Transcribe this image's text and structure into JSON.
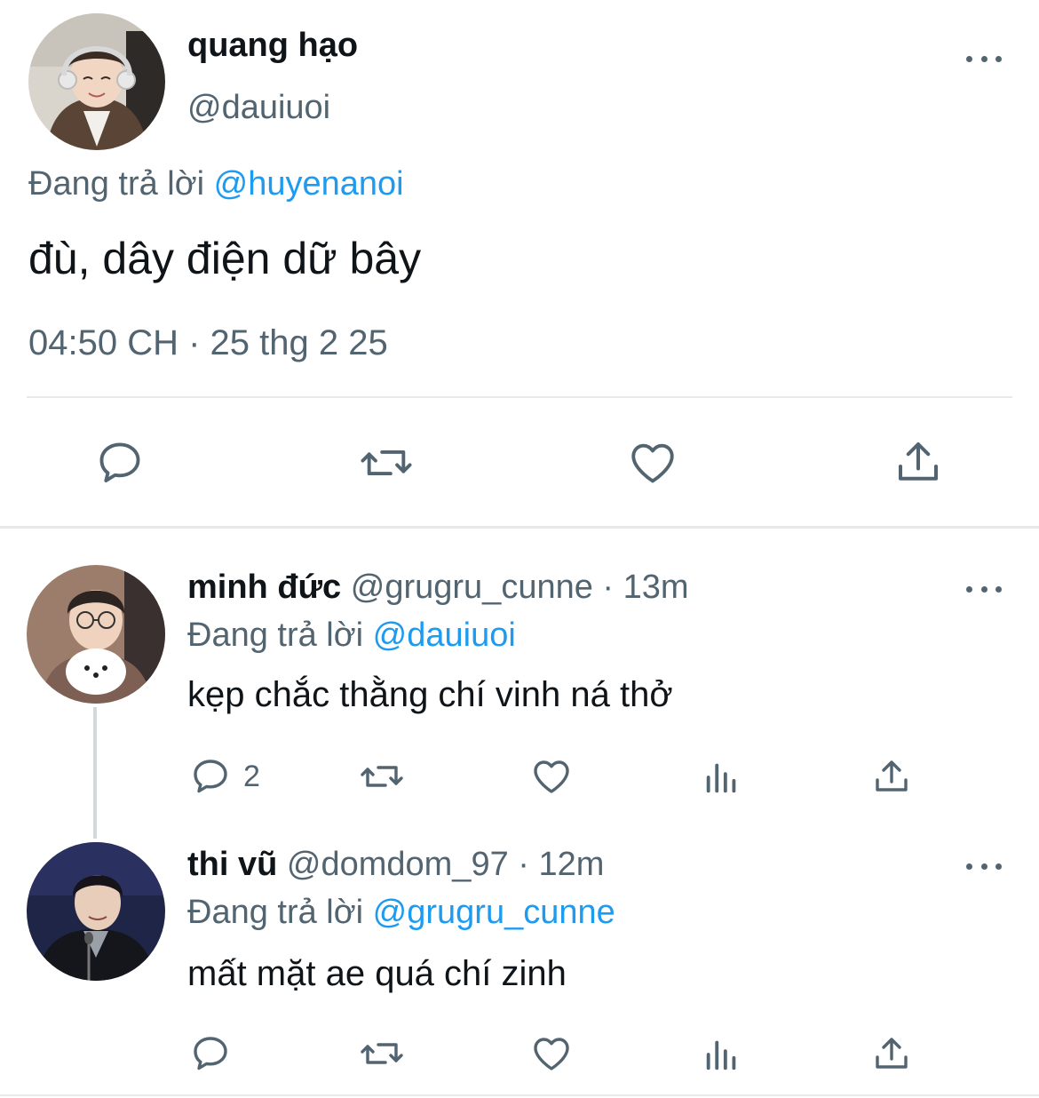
{
  "main_tweet": {
    "display_name": "quang hạo",
    "handle": "@dauiuoi",
    "replying_to_prefix": "Đang trả lời",
    "replying_to_handle": "@huyenanoi",
    "text": "đù, dây điện dữ bây",
    "timestamp": "04:50 CH · 25 thg 2 25",
    "actions": [
      "reply-icon",
      "retweet-icon",
      "like-icon",
      "share-icon"
    ]
  },
  "replies": [
    {
      "display_name": "minh đức",
      "handle": "@grugru_cunne",
      "time": "· 13m",
      "replying_to_prefix": "Đang trả lời",
      "replying_to_handle": "@dauiuoi",
      "text": "kẹp chắc thằng chí vinh ná thở",
      "reply_count": "2",
      "actions": [
        "reply-icon",
        "retweet-icon",
        "like-icon",
        "analytics-icon",
        "share-icon"
      ]
    },
    {
      "display_name": "thi vũ",
      "handle": "@domdom_97",
      "time": "· 12m",
      "replying_to_prefix": "Đang trả lời",
      "replying_to_handle": "@grugru_cunne",
      "text": "mất mặt ae quá chí zinh",
      "reply_count": "",
      "actions": [
        "reply-icon",
        "retweet-icon",
        "like-icon",
        "analytics-icon",
        "share-icon"
      ]
    }
  ],
  "colors": {
    "text": "#0f1419",
    "muted": "#536471",
    "link": "#1d9bf0",
    "divider": "#e7e9ea"
  }
}
